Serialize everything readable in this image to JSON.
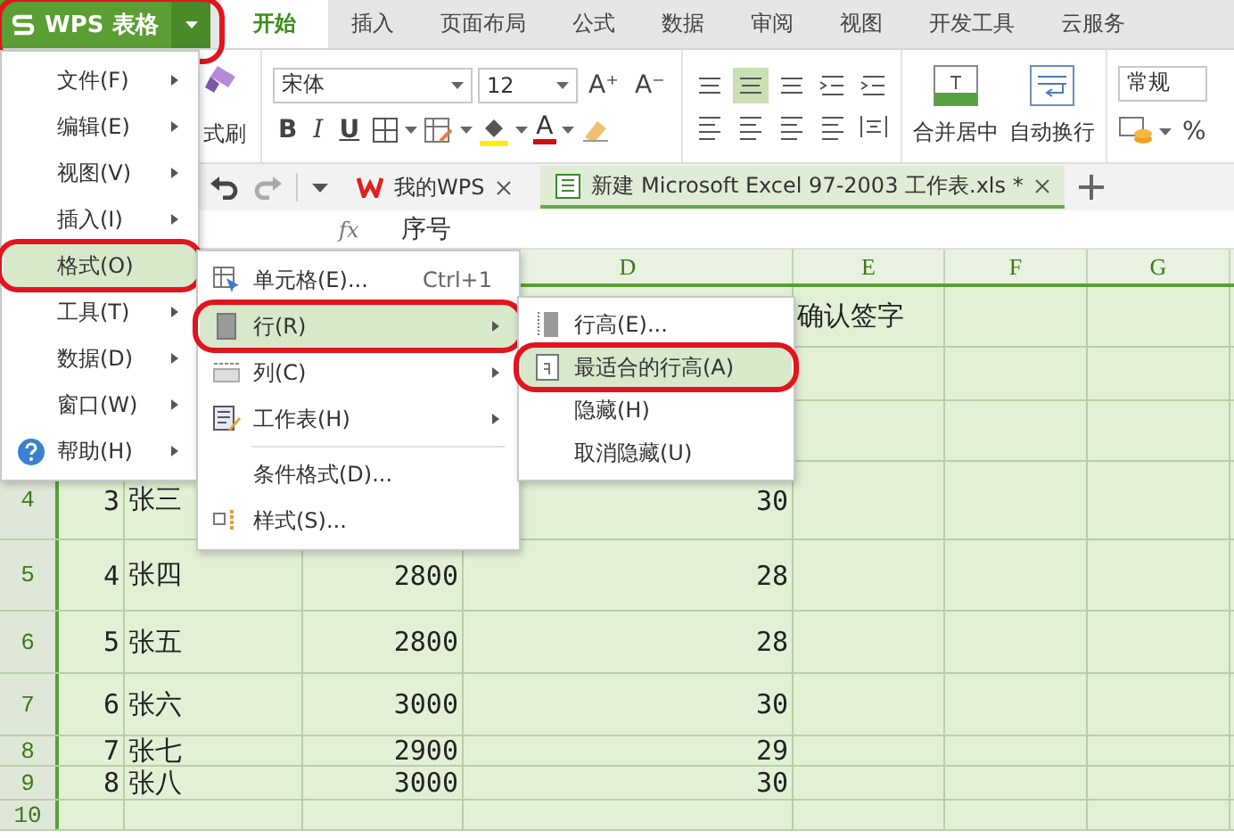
{
  "app_menu": {
    "label": "WPS 表格",
    "circled": true
  },
  "tabs": [
    {
      "label": "开始",
      "selected": true
    },
    {
      "label": "插入",
      "selected": false
    },
    {
      "label": "页面布局",
      "selected": false
    },
    {
      "label": "公式",
      "selected": false
    },
    {
      "label": "数据",
      "selected": false
    },
    {
      "label": "审阅",
      "selected": false
    },
    {
      "label": "视图",
      "selected": false
    },
    {
      "label": "开发工具",
      "selected": false
    },
    {
      "label": "云服务",
      "selected": false
    }
  ],
  "ribbon": {
    "painter_label": "式刷",
    "font": "宋体",
    "size": "12",
    "grow": "A⁺",
    "shrink": "A⁻",
    "bold": "B",
    "italic": "I",
    "underline": "U",
    "font_color": "A",
    "merge_label": "合并居中",
    "wrap_label": "自动换行",
    "number_format": "常规",
    "percent": "%"
  },
  "doc_tabs": [
    {
      "label": "我的WPS",
      "selected": false,
      "kind": "home"
    },
    {
      "label": "新建 Microsoft Excel 97-2003 工作表.xls *",
      "selected": true,
      "kind": "sheet"
    }
  ],
  "formula_bar": {
    "fx": "fx",
    "value": "序号"
  },
  "columns": [
    {},
    {},
    {},
    {
      "label": "D"
    },
    {
      "label": "E"
    },
    {
      "label": "F"
    },
    {
      "label": "G"
    },
    {}
  ],
  "rows": [
    {
      "cells": {
        "E": "确认签字"
      }
    },
    {
      "cells": {}
    },
    {
      "cells": {}
    },
    {
      "number": "4",
      "cells": {
        "A": "3",
        "B": "张三",
        "D": "30"
      }
    },
    {
      "number": "5",
      "cells": {
        "A": "4",
        "B": "张四",
        "C": "2800",
        "D": "28"
      }
    },
    {
      "number": "6",
      "cells": {
        "A": "5",
        "B": "张五",
        "C": "2800",
        "D": "28"
      }
    },
    {
      "number": "7",
      "cells": {
        "A": "6",
        "B": "张六",
        "C": "3000",
        "D": "30"
      }
    },
    {
      "number": "8",
      "cells": {
        "A": "7",
        "B": "张七",
        "C": "2900",
        "D": "29"
      }
    },
    {
      "number": "9",
      "cells": {
        "A": "8",
        "B": "张八",
        "C": "3000",
        "D": "30"
      }
    },
    {
      "number": "10",
      "cells": {}
    }
  ],
  "main_menu": [
    {
      "label": "文件(F)",
      "kind": "plain",
      "submenu": true,
      "selected": false,
      "circled": false
    },
    {
      "label": "编辑(E)",
      "kind": "plain",
      "submenu": true,
      "selected": false,
      "circled": false
    },
    {
      "label": "视图(V)",
      "kind": "plain",
      "submenu": true,
      "selected": false,
      "circled": false
    },
    {
      "label": "插入(I)",
      "kind": "plain",
      "submenu": true,
      "selected": false,
      "circled": false
    },
    {
      "label": "格式(O)",
      "kind": "plain",
      "submenu": false,
      "selected": true,
      "circled": true
    },
    {
      "label": "工具(T)",
      "kind": "plain",
      "submenu": true,
      "selected": false,
      "circled": false
    },
    {
      "label": "数据(D)",
      "kind": "plain",
      "submenu": true,
      "selected": false,
      "circled": false
    },
    {
      "label": "窗口(W)",
      "kind": "plain",
      "submenu": true,
      "selected": false,
      "circled": false
    },
    {
      "label": "帮助(H)",
      "kind": "help",
      "submenu": true,
      "selected": false,
      "circled": false
    }
  ],
  "format_menu": [
    {
      "label": "单元格(E)...",
      "shortcut": "Ctrl+1",
      "kind": "cell",
      "submenu": false,
      "selected": false,
      "circled": false,
      "separator_before": false
    },
    {
      "label": "行(R)",
      "kind": "row",
      "submenu": true,
      "selected": true,
      "circled": true,
      "separator_before": false
    },
    {
      "label": "列(C)",
      "kind": "column",
      "submenu": true,
      "selected": false,
      "circled": false,
      "separator_before": false
    },
    {
      "label": "工作表(H)",
      "kind": "sheet",
      "submenu": true,
      "selected": false,
      "circled": false,
      "separator_before": false
    },
    {
      "label": "条件格式(D)...",
      "kind": "none",
      "submenu": false,
      "selected": false,
      "circled": false,
      "separator_before": true
    },
    {
      "label": "样式(S)...",
      "kind": "style",
      "submenu": false,
      "selected": false,
      "circled": false,
      "separator_before": false
    }
  ],
  "row_menu": [
    {
      "label": "行高(E)...",
      "kind": "row-height",
      "selected": false,
      "circled": false
    },
    {
      "label": "最适合的行高(A)",
      "kind": "fit",
      "selected": true,
      "circled": true
    },
    {
      "label": "隐藏(H)",
      "kind": "none",
      "selected": false,
      "circled": false
    },
    {
      "label": "取消隐藏(U)",
      "kind": "none",
      "selected": false,
      "circled": false
    }
  ]
}
